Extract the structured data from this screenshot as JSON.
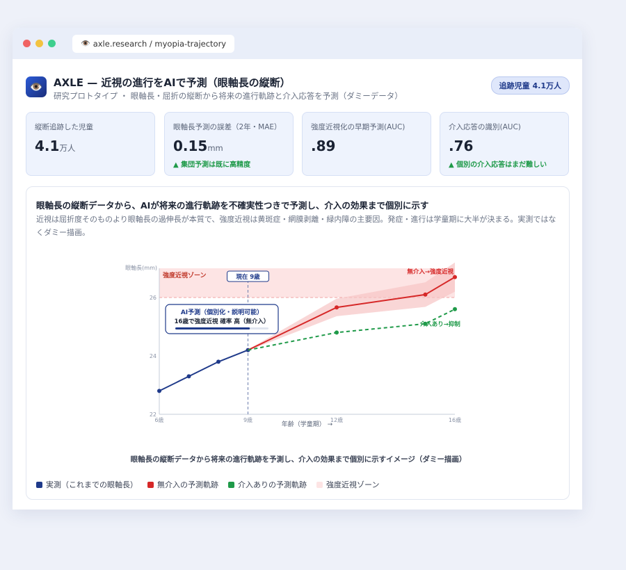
{
  "browser": {
    "url": "axle.research / myopia-trajectory",
    "url_icon": "👁️"
  },
  "header": {
    "logo_icon": "👁️",
    "title": "AXLE — 近視の進行をAIで予測（眼軸長の縦断）",
    "subtitle": "研究プロトタイプ ・ 眼軸長・屈折の縦断から将来の進行軌跡と介入応答を予測（ダミーデータ）",
    "badge": "追跡児童 4.1万人"
  },
  "kpis": [
    {
      "label": "縦断追跡した児童",
      "value": "4.1",
      "unit": "万人",
      "note": ""
    },
    {
      "label": "眼軸長予測の誤差（2年・MAE）",
      "value": "0.15",
      "unit": "mm",
      "note": "▲ 集団予測は既に高精度"
    },
    {
      "label": "強度近視化の早期予測(AUC)",
      "value": ".89",
      "unit": "",
      "note": ""
    },
    {
      "label": "介入応答の識別(AUC)",
      "value": ".76",
      "unit": "",
      "note": "▲ 個別の介入応答はまだ難しい"
    }
  ],
  "panel": {
    "title": "眼軸長の縦断データから、AIが将来の進行軌跡を不確実性つきで予測し、介入の効果まで個別に示す",
    "desc": "近視は屈折度そのものより眼軸長の過伸長が本質で、強度近視は黄斑症・網膜剥離・緑内障の主要因。発症・進行は学童期に大半が決まる。実測ではなくダミー描画。",
    "caption": "眼軸長の縦断データから将来の進行軌跡を予測し、介入の効果まで個別に示すイメージ（ダミー描画）"
  },
  "legend": [
    {
      "label": "実測（これまでの眼軸長）",
      "color": "#1f3a8a"
    },
    {
      "label": "無介入の予測軌跡",
      "color": "#d62828"
    },
    {
      "label": "介入ありの予測軌跡",
      "color": "#1f9a49"
    },
    {
      "label": "強度近視ゾーン",
      "color": "#fde4e4"
    }
  ],
  "chart_data": {
    "type": "line",
    "ylabel": "眼軸長(mm)",
    "xlabel": "年齢（学童期） →",
    "xlim": [
      6,
      16
    ],
    "ylim": [
      22,
      27
    ],
    "x_ticks": [
      6,
      9,
      12,
      16
    ],
    "x_tick_labels": [
      "6歳",
      "9歳",
      "12歳",
      "16歳"
    ],
    "y_ticks": [
      22,
      24,
      26
    ],
    "zone": {
      "label": "強度近視ゾーン",
      "from": 26,
      "to": 27,
      "color": "#fde4e4"
    },
    "current": {
      "x": 9,
      "label": "現在 9歳"
    },
    "series": [
      {
        "name": "実測",
        "color": "#1f3a8a",
        "dashed": false,
        "points": [
          [
            6,
            22.8
          ],
          [
            7,
            23.3
          ],
          [
            8,
            23.8
          ],
          [
            9,
            24.2
          ]
        ]
      },
      {
        "name": "無介入→強度近視",
        "color": "#d62828",
        "dashed": false,
        "points": [
          [
            9,
            24.2
          ],
          [
            12,
            25.66
          ],
          [
            15,
            26.1
          ],
          [
            16,
            26.7
          ]
        ],
        "band": [
          [
            9,
            0.02
          ],
          [
            12,
            0.3
          ],
          [
            15,
            0.42
          ],
          [
            16,
            0.5
          ]
        ]
      },
      {
        "name": "介入あり→抑制",
        "color": "#1f9a49",
        "dashed": true,
        "points": [
          [
            9,
            24.2
          ],
          [
            12,
            24.8
          ],
          [
            15,
            25.1
          ],
          [
            16,
            25.6
          ]
        ]
      }
    ],
    "annotation": {
      "title": "AI予測（個別化・説明可能）",
      "text": "16歳で強度近視 確率 高（無介入）",
      "meter": 0.8
    }
  }
}
